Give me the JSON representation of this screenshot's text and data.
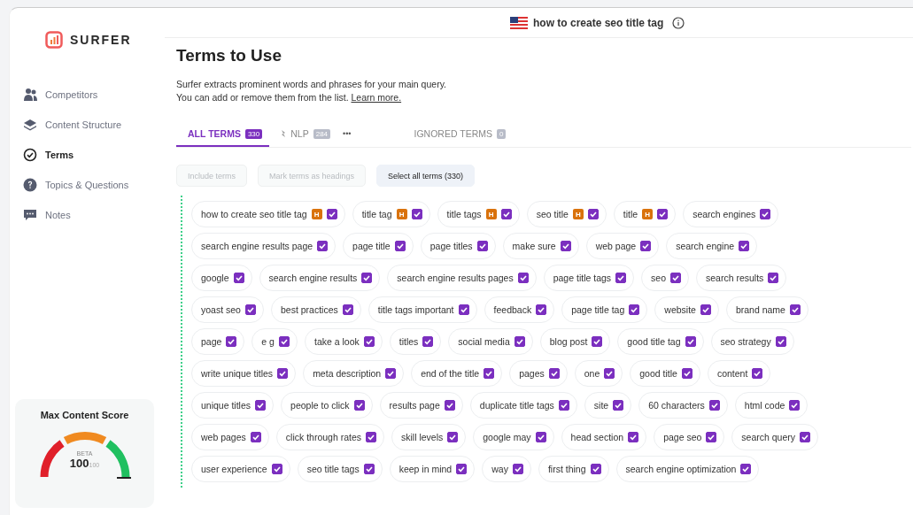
{
  "sidebar": {
    "logo": "SURFER",
    "items": [
      {
        "label": "Competitors",
        "selected": false
      },
      {
        "label": "Content Structure",
        "selected": false
      },
      {
        "label": "Terms",
        "selected": true
      },
      {
        "label": "Topics & Questions",
        "selected": false
      },
      {
        "label": "Notes",
        "selected": false
      }
    ],
    "score_card": {
      "title": "Max Content Score",
      "badge": "BETA",
      "score": "100",
      "max": "100"
    }
  },
  "query": {
    "text": "how to create seo title tag"
  },
  "title": "Terms to Use",
  "description": {
    "line_1": "Surfer extracts prominent words and phrases for your main query.",
    "line_2": "You can add or remove them from the list.",
    "link": "Learn more."
  },
  "tabs": [
    {
      "label": "ALL TERMS",
      "count": "330",
      "selected": true,
      "kind": "plain"
    },
    {
      "label": "NLP",
      "count": "284",
      "selected": false,
      "kind": "nlp"
    },
    {
      "label": "•••",
      "selected": false,
      "kind": "more"
    },
    {
      "label": "IGNORED TERMS",
      "count": "0",
      "selected": false,
      "kind": "plain"
    }
  ],
  "actions": [
    {
      "label": "Include terms",
      "disabled": true
    },
    {
      "label": "Mark terms as headings",
      "disabled": true
    },
    {
      "label": "Select all terms (330)",
      "disabled": false
    }
  ],
  "term_rows": [
    {
      "terms": [
        {
          "text": "how to create seo title tag",
          "heading": "H",
          "checked": true
        },
        {
          "text": "title tag",
          "heading": "H",
          "checked": true
        },
        {
          "text": "title tags",
          "heading": "H",
          "checked": true
        },
        {
          "text": "seo title",
          "heading": "H",
          "checked": true
        },
        {
          "text": "title",
          "heading": "H",
          "checked": true
        },
        {
          "text": "search engines",
          "checked": true
        }
      ]
    },
    {
      "terms": [
        {
          "text": "search engine results page",
          "checked": true
        },
        {
          "text": "page title",
          "checked": true
        },
        {
          "text": "page titles",
          "checked": true
        },
        {
          "text": "make sure",
          "checked": true
        },
        {
          "text": "web page",
          "checked": true
        },
        {
          "text": "search engine",
          "checked": true
        }
      ]
    },
    {
      "terms": [
        {
          "text": "google",
          "checked": true
        },
        {
          "text": "search engine results",
          "checked": true
        },
        {
          "text": "search engine results pages",
          "checked": true
        },
        {
          "text": "page title tags",
          "checked": true
        },
        {
          "text": "seo",
          "checked": true
        },
        {
          "text": "search results",
          "checked": true
        }
      ]
    },
    {
      "terms": [
        {
          "text": "yoast seo",
          "checked": true
        },
        {
          "text": "best practices",
          "checked": true
        },
        {
          "text": "title tags important",
          "checked": true
        },
        {
          "text": "feedback",
          "checked": true
        },
        {
          "text": "page title tag",
          "checked": true
        },
        {
          "text": "website",
          "checked": true
        },
        {
          "text": "brand name",
          "checked": true
        }
      ]
    },
    {
      "terms": [
        {
          "text": "page",
          "checked": true
        },
        {
          "text": "e g",
          "checked": true
        },
        {
          "text": "take a look",
          "checked": true
        },
        {
          "text": "titles",
          "checked": true
        },
        {
          "text": "social media",
          "checked": true
        },
        {
          "text": "blog post",
          "checked": true
        },
        {
          "text": "good title tag",
          "checked": true
        },
        {
          "text": "seo strategy",
          "checked": true
        }
      ]
    },
    {
      "terms": [
        {
          "text": "write unique titles",
          "checked": true
        },
        {
          "text": "meta description",
          "checked": true
        },
        {
          "text": "end of the title",
          "checked": true
        },
        {
          "text": "pages",
          "checked": true
        },
        {
          "text": "one",
          "checked": true
        },
        {
          "text": "good title",
          "checked": true
        },
        {
          "text": "content",
          "checked": true
        }
      ]
    },
    {
      "terms": [
        {
          "text": "unique titles",
          "checked": true
        },
        {
          "text": "people to click",
          "checked": true
        },
        {
          "text": "results page",
          "checked": true
        },
        {
          "text": "duplicate title tags",
          "checked": true
        },
        {
          "text": "site",
          "checked": true
        },
        {
          "text": "60 characters",
          "checked": true
        },
        {
          "text": "html code",
          "checked": true
        }
      ]
    },
    {
      "terms": [
        {
          "text": "web pages",
          "checked": true
        },
        {
          "text": "click through rates",
          "checked": true
        },
        {
          "text": "skill levels",
          "checked": true
        },
        {
          "text": "google may",
          "checked": true
        },
        {
          "text": "head section",
          "checked": true
        },
        {
          "text": "page seo",
          "checked": true
        },
        {
          "text": "search query",
          "checked": true
        }
      ]
    },
    {
      "terms": [
        {
          "text": "user experience",
          "checked": true
        },
        {
          "text": "seo title tags",
          "checked": true
        },
        {
          "text": "keep in mind",
          "checked": true
        },
        {
          "text": "way",
          "checked": true
        },
        {
          "text": "first thing",
          "checked": true
        },
        {
          "text": "search engine optimization",
          "checked": true
        }
      ]
    }
  ]
}
